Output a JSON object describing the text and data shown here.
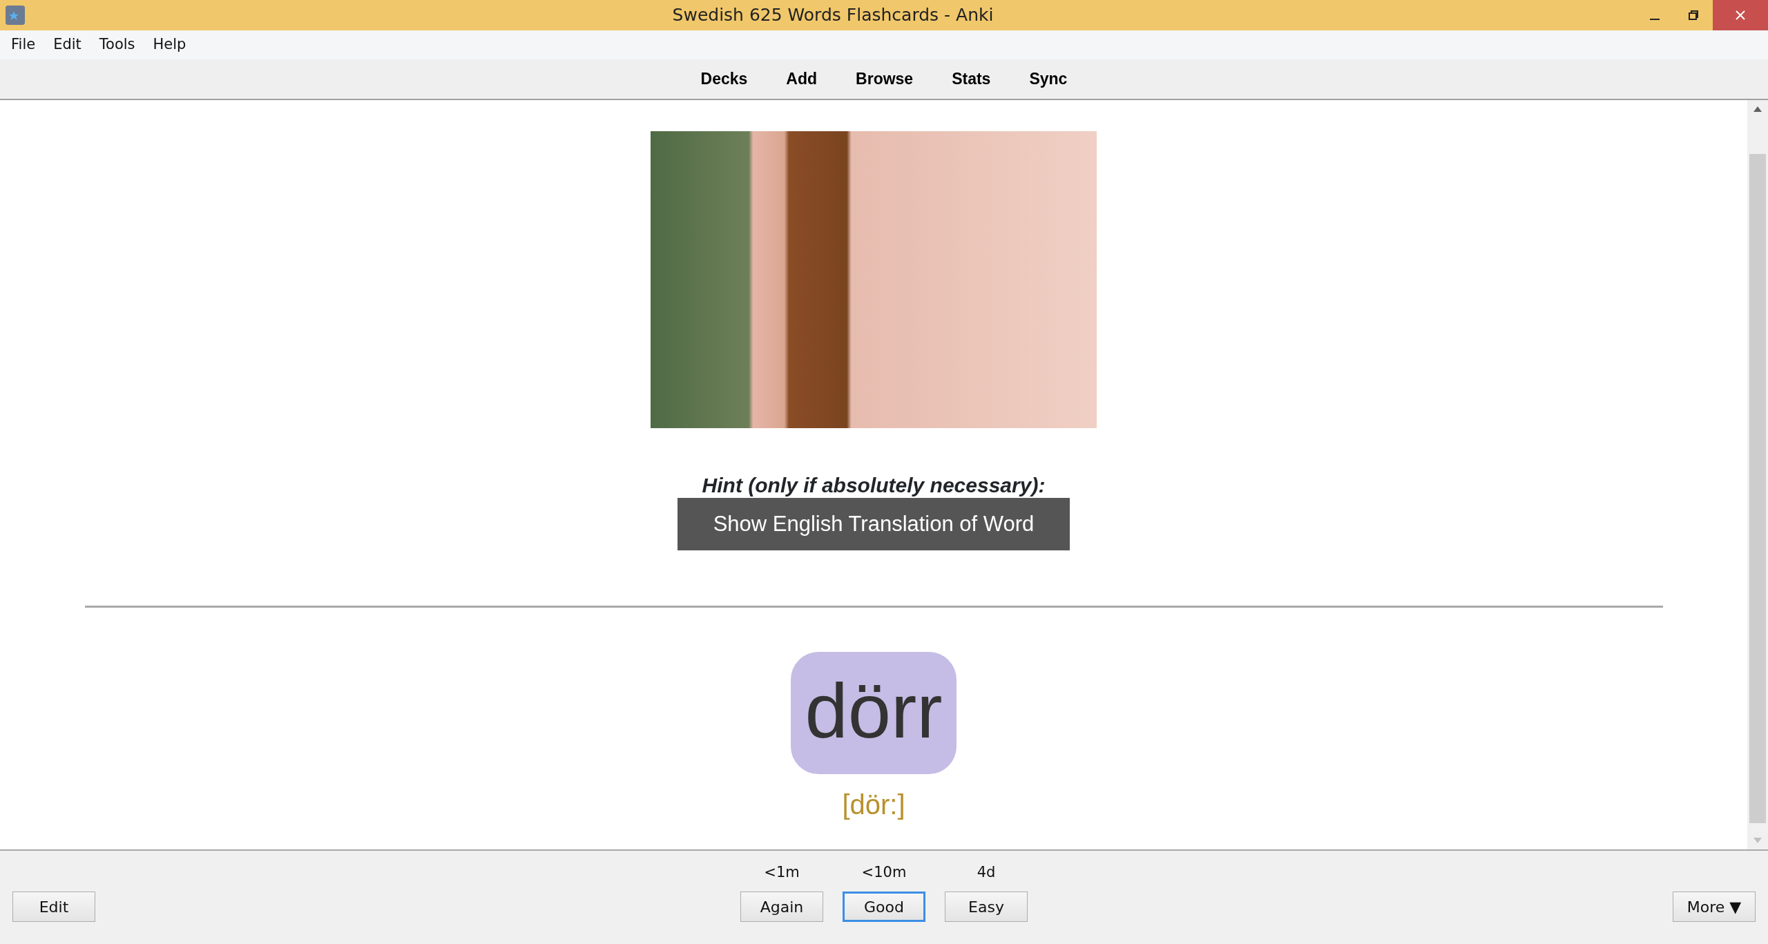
{
  "window": {
    "title": "Swedish 625 Words Flashcards - Anki"
  },
  "menu": [
    "File",
    "Edit",
    "Tools",
    "Help"
  ],
  "toolbar": [
    "Decks",
    "Add",
    "Browse",
    "Stats",
    "Sync"
  ],
  "card": {
    "hint_label": "Hint (only if absolutely necessary):",
    "hint_button": "Show English Translation of Word",
    "word": "dörr",
    "pronunciation": "[dör:]"
  },
  "bottom_bar": {
    "edit_button": "Edit",
    "answers": [
      {
        "interval": "<1m",
        "label": "Again",
        "default": false
      },
      {
        "interval": "<10m",
        "label": "Good",
        "default": true
      },
      {
        "interval": "4d",
        "label": "Easy",
        "default": false
      }
    ],
    "more_button": "More ▼"
  }
}
